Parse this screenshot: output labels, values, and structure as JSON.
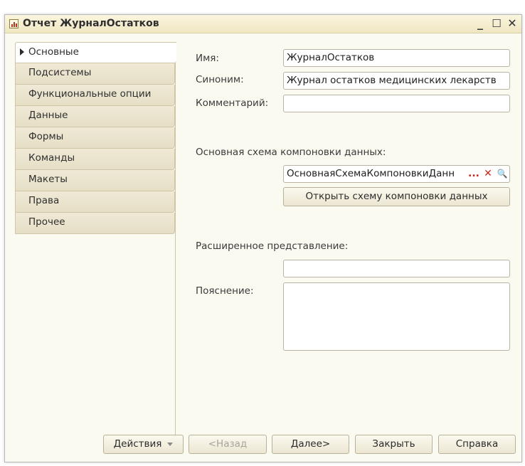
{
  "window": {
    "title": "Отчет ЖурналОстатков",
    "minimize": "_",
    "maximize": "☐",
    "close": "✕"
  },
  "tabs": [
    {
      "label": "Основные",
      "active": true
    },
    {
      "label": "Подсистемы"
    },
    {
      "label": "Функциональные опции"
    },
    {
      "label": "Данные"
    },
    {
      "label": "Формы"
    },
    {
      "label": "Команды"
    },
    {
      "label": "Макеты"
    },
    {
      "label": "Права"
    },
    {
      "label": "Прочее"
    }
  ],
  "form": {
    "name_label": "Имя:",
    "name_value": "ЖурналОстатков",
    "synonym_label": "Синоним:",
    "synonym_value": "Журнал остатков медицинских лекарств",
    "comment_label": "Комментарий:",
    "comment_value": "",
    "dcs_label": "Основная схема компоновки данных:",
    "dcs_value": "ОсновнаяСхемаКомпоновкиДанн",
    "dcs_choose": "...",
    "dcs_clear": "✕",
    "dcs_open": "🔍",
    "open_dcs_button": "Открыть схему компоновки данных",
    "extended_label": "Расширенное представление:",
    "extended_value": "",
    "explanation_label": "Пояснение:",
    "explanation_value": ""
  },
  "footer": {
    "actions": "Действия",
    "back": "<Назад",
    "next": "Далее>",
    "close": "Закрыть",
    "help": "Справка"
  },
  "colors": {
    "accent_red": "#c8261b",
    "tab_bg": "#e6dfc6",
    "window_bg": "#fbfaf0"
  }
}
